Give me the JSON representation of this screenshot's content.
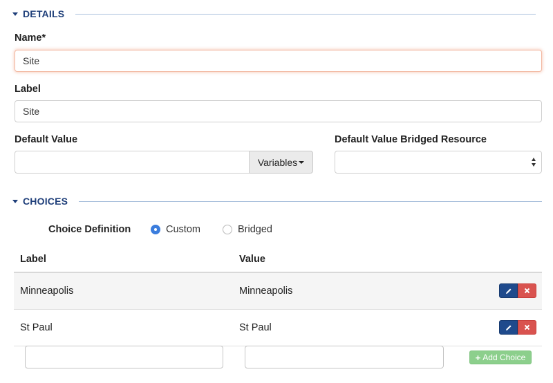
{
  "details": {
    "section_title": "DETAILS",
    "name_label": "Name*",
    "name_value": "Site",
    "label_label": "Label",
    "label_value": "Site",
    "default_value_label": "Default Value",
    "default_value": "",
    "variables_button": "Variables",
    "bridged_resource_label": "Default Value Bridged Resource",
    "bridged_resource_value": ""
  },
  "choices": {
    "section_title": "CHOICES",
    "definition_label": "Choice Definition",
    "options": [
      {
        "label": "Custom",
        "checked": true
      },
      {
        "label": "Bridged",
        "checked": false
      }
    ],
    "columns": [
      "Label",
      "Value"
    ],
    "rows": [
      {
        "label": "Minneapolis",
        "value": "Minneapolis"
      },
      {
        "label": "St Paul",
        "value": "St Paul"
      }
    ],
    "new_label": "",
    "new_value": "",
    "add_button": "Add Choice"
  },
  "icons": {
    "section_toggle": "caret-down-icon",
    "edit": "pencil-icon",
    "delete": "x-icon",
    "add": "plus-icon"
  },
  "colors": {
    "header": "#1f3f7a",
    "edit_button": "#1f4a8c",
    "delete_button": "#d9534f",
    "add_button": "#8ccf8c",
    "radio_checked": "#3b7ddd"
  }
}
